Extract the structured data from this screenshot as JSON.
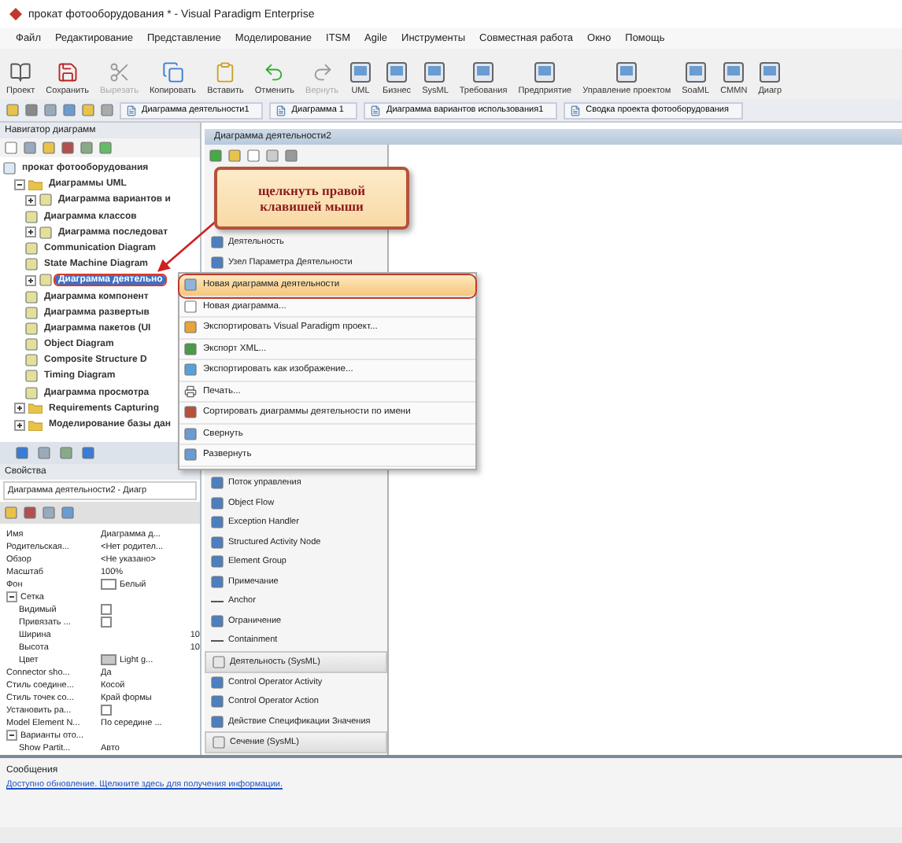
{
  "window": {
    "title": "прокат фотооборудования * - Visual Paradigm Enterprise"
  },
  "menu": [
    "Файл",
    "Редактирование",
    "Представление",
    "Моделирование",
    "ITSM",
    "Agile",
    "Инструменты",
    "Совместная работа",
    "Окно",
    "Помощь"
  ],
  "toolbar": [
    {
      "label": "Проект",
      "kind": "book",
      "disabled": false
    },
    {
      "label": "Сохранить",
      "kind": "save",
      "disabled": false
    },
    {
      "label": "Вырезать",
      "kind": "cut",
      "disabled": true
    },
    {
      "label": "Копировать",
      "kind": "copy",
      "disabled": false
    },
    {
      "label": "Вставить",
      "kind": "paste",
      "disabled": false
    },
    {
      "label": "Отменить",
      "kind": "undo",
      "disabled": false
    },
    {
      "label": "Вернуть",
      "kind": "redo",
      "disabled": true
    },
    {
      "label": "UML",
      "kind": "diagram",
      "disabled": false
    },
    {
      "label": "Бизнес",
      "kind": "diagram",
      "disabled": false
    },
    {
      "label": "SysML",
      "kind": "diagram",
      "disabled": false
    },
    {
      "label": "Требования",
      "kind": "diagram",
      "disabled": false
    },
    {
      "label": "Предприятие",
      "kind": "diagram",
      "disabled": false
    },
    {
      "label": "Управление проектом",
      "kind": "diagram",
      "disabled": false
    },
    {
      "label": "SoaML",
      "kind": "diagram",
      "disabled": false
    },
    {
      "label": "CMMN",
      "kind": "diagram",
      "disabled": false
    },
    {
      "label": "Диагр",
      "kind": "diagram",
      "disabled": false
    }
  ],
  "tabs": [
    "Диаграмма деятельности1",
    "Диаграмма 1",
    "Диаграмма вариантов использования1",
    "Сводка проекта фотооборудования"
  ],
  "navigator": {
    "title": "Навигатор диаграмм",
    "tree": [
      {
        "label": "прокат фотооборудования",
        "selected": false,
        "children": [
          {
            "label": "Диаграммы UML",
            "expanded": true,
            "selected": false,
            "children": [
              {
                "label": "Диаграмма вариантов и",
                "expanded": false,
                "selected": false
              },
              {
                "label": "Диаграмма классов",
                "selected": false
              },
              {
                "label": "Диаграмма последоват",
                "expanded": false,
                "selected": false
              },
              {
                "label": "Communication Diagram",
                "selected": false
              },
              {
                "label": "State Machine Diagram",
                "selected": false
              },
              {
                "label": "Диаграмма деятельно",
                "expanded": false,
                "selected": true
              },
              {
                "label": "Диаграмма компонент",
                "selected": false
              },
              {
                "label": "Диаграмма развертыв",
                "selected": false
              },
              {
                "label": "Диаграмма пакетов (UI",
                "selected": false
              },
              {
                "label": "Object Diagram",
                "selected": false
              },
              {
                "label": "Composite Structure D",
                "selected": false
              },
              {
                "label": "Timing Diagram",
                "selected": false
              },
              {
                "label": "Диаграмма просмотра",
                "selected": false
              }
            ]
          },
          {
            "label": "Requirements Capturing",
            "expanded": false,
            "selected": false
          },
          {
            "label": "Моделирование базы дан",
            "expanded": false,
            "selected": false
          }
        ]
      }
    ]
  },
  "properties": {
    "title": "Свойства",
    "selector": "Диаграмма деятельности2 - Диагр",
    "rows": [
      {
        "kind": "text",
        "name": "Имя",
        "value": "Диаграмма д..."
      },
      {
        "kind": "text",
        "name": "Родительская...",
        "value": "<Нет родител..."
      },
      {
        "kind": "text",
        "name": "Обзор",
        "value": "<Не указано>"
      },
      {
        "kind": "text",
        "name": "Масштаб",
        "value": "100%"
      },
      {
        "kind": "color",
        "name": "Фон",
        "value": "Белый",
        "color": "#ffffff"
      },
      {
        "kind": "group",
        "name": "Сетка",
        "expanded": true,
        "children": [
          {
            "kind": "checkbox",
            "name": "Видимый",
            "checked": false
          },
          {
            "kind": "checkbox",
            "name": "Привязать ...",
            "checked": false
          },
          {
            "kind": "number",
            "name": "Ширина",
            "value": "10"
          },
          {
            "kind": "number",
            "name": "Высота",
            "value": "10"
          },
          {
            "kind": "color",
            "name": "Цвет",
            "value": "Light g...",
            "color": "#c8c8c8"
          }
        ]
      },
      {
        "kind": "text",
        "name": "Connector sho...",
        "value": "Да"
      },
      {
        "kind": "text",
        "name": "Стиль соедине...",
        "value": "Косой"
      },
      {
        "kind": "text",
        "name": "Стиль точек со...",
        "value": "Край формы"
      },
      {
        "kind": "checkbox",
        "name": "Установить ра...",
        "checked": false
      },
      {
        "kind": "text",
        "name": "Model Element N...",
        "value": "По середине ..."
      },
      {
        "kind": "group",
        "name": "Варианты ото...",
        "expanded": true,
        "children": [
          {
            "kind": "text",
            "name": "Show Partit...",
            "value": "Авто"
          }
        ]
      }
    ]
  },
  "diagram": {
    "title": "Диаграмма деятельности2",
    "palette_top": [
      {
        "kind": "item",
        "label": "Деятельность"
      },
      {
        "kind": "item",
        "label": "Узел Параметра Деятельности"
      }
    ],
    "palette": [
      {
        "kind": "item",
        "label": "Поток управления"
      },
      {
        "kind": "item",
        "label": "Object Flow"
      },
      {
        "kind": "item",
        "label": "Exception Handler"
      },
      {
        "kind": "item",
        "label": "Structured Activity Node"
      },
      {
        "kind": "item",
        "label": "Element Group"
      },
      {
        "kind": "item",
        "label": "Примечание"
      },
      {
        "kind": "line",
        "label": "Anchor"
      },
      {
        "kind": "item",
        "label": "Ограничение"
      },
      {
        "kind": "line",
        "label": "Containment"
      },
      {
        "kind": "section",
        "label": "Деятельность (SysML)"
      },
      {
        "kind": "item",
        "label": "Control Operator Activity"
      },
      {
        "kind": "item",
        "label": "Control Operator Action"
      },
      {
        "kind": "item",
        "label": "Действие Спецификации Значения"
      },
      {
        "kind": "section",
        "label": "Сечение (SysML)"
      }
    ],
    "callout": "щелкнуть правой клавишей мыши",
    "context_menu": [
      {
        "label": "Новая диаграмма деятельности",
        "selected": true
      },
      {
        "label": "Новая диаграмма...",
        "selected": false
      },
      {
        "label": "Экспортировать Visual Paradigm проект...",
        "selected": false
      },
      {
        "label": "Экспорт XML...",
        "selected": false
      },
      {
        "label": "Экспортировать как изображение...",
        "selected": false
      },
      {
        "label": "Печать...",
        "selected": false
      },
      {
        "label": "Сортировать диаграммы деятельности по имени",
        "selected": false
      },
      {
        "label": "Свернуть",
        "selected": false
      },
      {
        "label": "Развернуть",
        "selected": false
      }
    ]
  },
  "messages": {
    "title": "Сообщения",
    "link": "Доступно обновление. Щелкните здесь для получения информации."
  }
}
